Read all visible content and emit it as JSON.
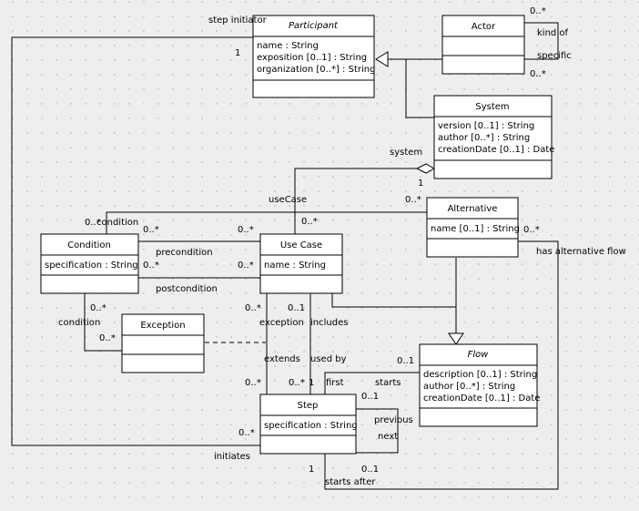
{
  "diagram": {
    "type": "UML class diagram",
    "classes": {
      "participant": {
        "name": "Participant",
        "abstract": true,
        "attributes": [
          "name : String",
          "exposition [0..1] : String",
          "organization [0..*] : String"
        ]
      },
      "actor": {
        "name": "Actor",
        "abstract": false,
        "attributes": []
      },
      "system": {
        "name": "System",
        "abstract": false,
        "attributes": [
          "version [0..1] : String",
          "author [0..*] : String",
          "creationDate [0..1] : Date"
        ]
      },
      "alternative": {
        "name": "Alternative",
        "abstract": false,
        "attributes": [
          "name [0..1] : String"
        ]
      },
      "condition": {
        "name": "Condition",
        "abstract": false,
        "attributes": [
          "specification : String"
        ]
      },
      "usecase": {
        "name": "Use Case",
        "abstract": false,
        "attributes": [
          "name : String"
        ]
      },
      "exception": {
        "name": "Exception",
        "abstract": false,
        "attributes": []
      },
      "flow": {
        "name": "Flow",
        "abstract": true,
        "attributes": [
          "description [0..1] : String",
          "author [0..*] : String",
          "creationDate [0..1] : Date"
        ]
      },
      "step": {
        "name": "Step",
        "abstract": false,
        "attributes": [
          "specification : String"
        ]
      }
    },
    "labels": {
      "step_initiator": "step initiator",
      "step_initiator_mult": "1",
      "actor_mult_top": "0..*",
      "kind_of": "kind of",
      "specific": "specific",
      "actor_mult_bottom": "0..*",
      "system_role": "system",
      "system_mult": "1",
      "usecase_role": "useCase",
      "alt_mult_left": "0..*",
      "usecase_mult_top": "0..*",
      "alt_mult_right": "0..*",
      "has_alternative_flow": "has alternative flow",
      "condition_mult_top": "0..*",
      "condition_role_top": "condition",
      "cond_pre_mult_left": "0..*",
      "cond_pre_mult_right": "0..*",
      "precondition": "precondition",
      "cond_post_mult_left": "0..*",
      "cond_post_mult_right": "0..*",
      "postcondition": "postcondition",
      "cond_exc_mult_top": "0..*",
      "condition_role_bottom": "condition",
      "cond_exc_mult_bottom": "0..*",
      "uc_exc_mult": "0..*",
      "uc_inc_mult": "0..1",
      "exception_role": "exception",
      "includes": "includes",
      "extends": "extends",
      "used_by": "used by",
      "step_ext_mult": "0..*",
      "step_used_mult": "0..*",
      "step_used_one": "1",
      "first": "first",
      "starts": "starts",
      "flow_starts_mult": "0..1",
      "step_starts_mult": "0..1",
      "previous": "previous",
      "next": "next",
      "step_initiates_mult": "0..*",
      "initiates": "initiates",
      "starts_after_one": "1",
      "starts_after_mult": "0..1",
      "starts_after": "starts after"
    }
  }
}
